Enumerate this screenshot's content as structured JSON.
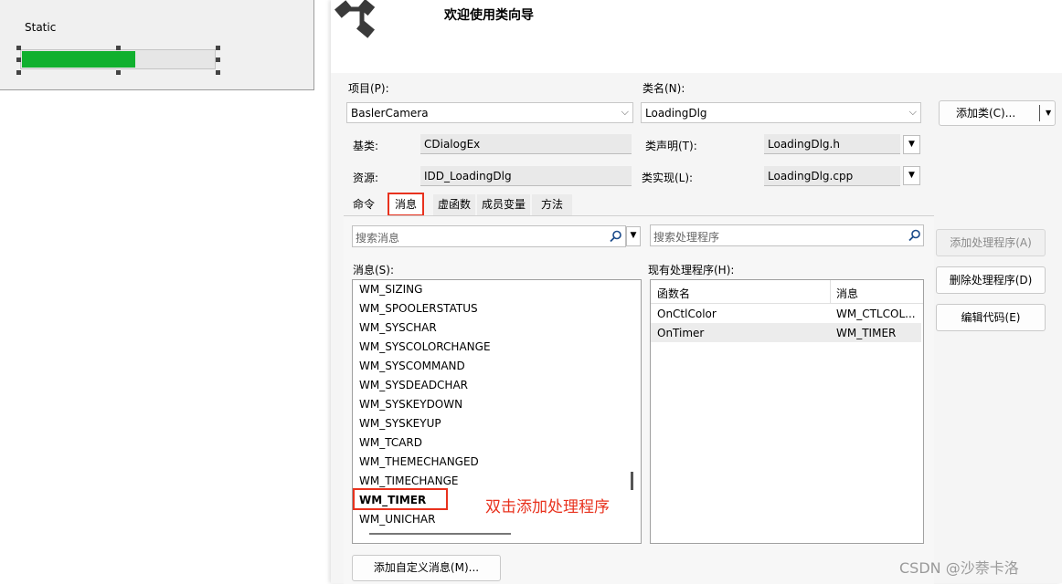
{
  "designer": {
    "static_label": "Static",
    "progress_fraction": 0.59,
    "progress_color": "#10b02e"
  },
  "wizard": {
    "title": "欢迎使用类向导",
    "project_label": "项目(P):",
    "project_value": "BaslerCamera",
    "class_label": "类名(N):",
    "class_value": "LoadingDlg",
    "add_class_button": "添加类(C)...",
    "base_class_label": "基类:",
    "base_class_value": "CDialogEx",
    "class_decl_label": "类声明(T):",
    "class_decl_value": "LoadingDlg.h",
    "resource_label": "资源:",
    "resource_value": "IDD_LoadingDlg",
    "class_impl_label": "类实现(L):",
    "class_impl_value": "LoadingDlg.cpp"
  },
  "tabs": [
    "命令",
    "消息",
    "虚函数",
    "成员变量",
    "方法"
  ],
  "messages_panel": {
    "search_placeholder": "搜索消息",
    "label": "消息(S):",
    "items": [
      "WM_SIZING",
      "WM_SPOOLERSTATUS",
      "WM_SYSCHAR",
      "WM_SYSCOLORCHANGE",
      "WM_SYSCOMMAND",
      "WM_SYSDEADCHAR",
      "WM_SYSKEYDOWN",
      "WM_SYSKEYUP",
      "WM_TCARD",
      "WM_THEMECHANGED",
      "WM_TIMECHANGE",
      "WM_TIMER",
      "WM_UNICHAR"
    ],
    "selected": "WM_TIMER",
    "annotation": "双击添加处理程序",
    "add_custom_button": "添加自定义消息(M)..."
  },
  "handlers_panel": {
    "search_placeholder": "搜索处理程序",
    "label": "现有处理程序(H):",
    "col_function": "函数名",
    "col_message": "消息",
    "rows": [
      {
        "function": "OnCtlColor",
        "message": "WM_CTLCOL..."
      },
      {
        "function": "OnTimer",
        "message": "WM_TIMER"
      }
    ]
  },
  "buttons": {
    "add_handler": "添加处理程序(A)",
    "delete_handler": "删除处理程序(D)",
    "edit_code": "编辑代码(E)"
  },
  "watermark": "CSDN @沙萘卡洛",
  "colors": {
    "highlight_red": "#e8321e"
  }
}
